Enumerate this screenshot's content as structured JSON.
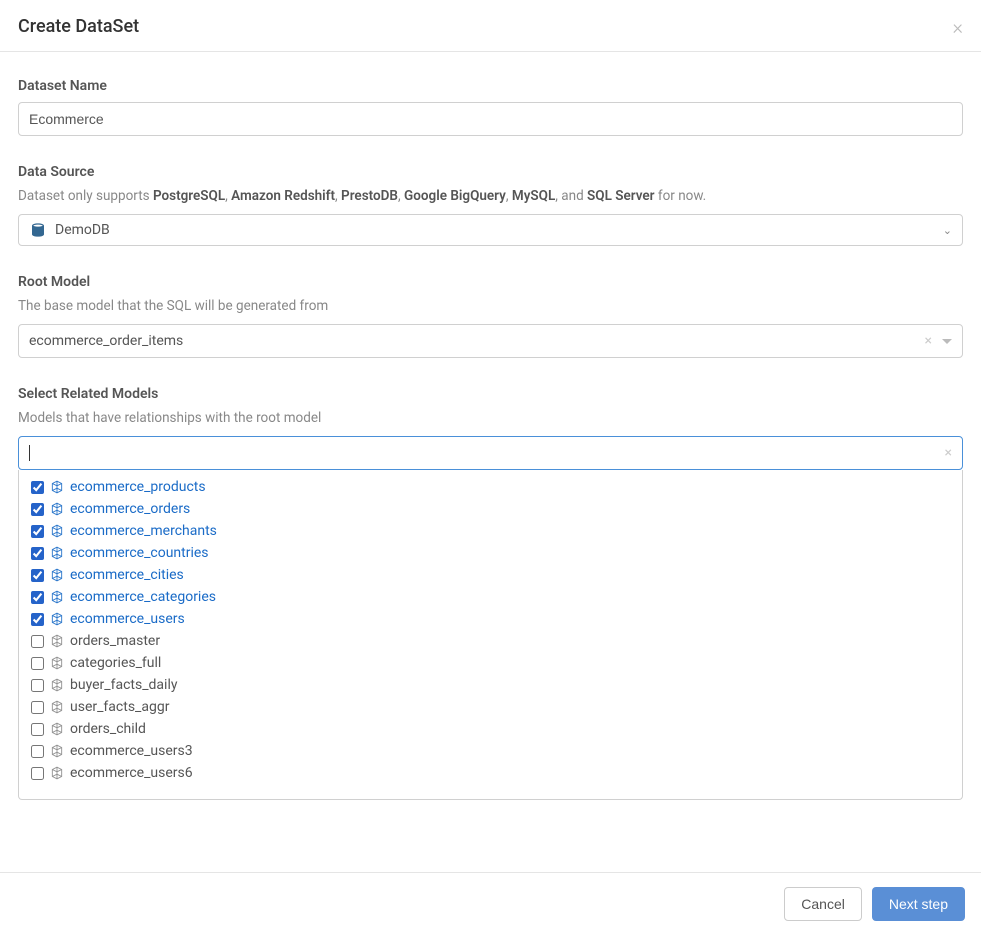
{
  "modal": {
    "title": "Create DataSet",
    "close": "×"
  },
  "dataset_name": {
    "label": "Dataset Name",
    "value": "Ecommerce"
  },
  "data_source": {
    "label": "Data Source",
    "help_prefix": "Dataset only supports ",
    "db1": "PostgreSQL",
    "sep1": ", ",
    "db2": "Amazon Redshift",
    "sep2": ", ",
    "db3": "PrestoDB",
    "sep3": ", ",
    "db4": "Google BigQuery",
    "sep4": ", ",
    "db5": "MySQL",
    "sep5": ", and ",
    "db6": "SQL Server",
    "help_suffix": " for now.",
    "selected": "DemoDB"
  },
  "root_model": {
    "label": "Root Model",
    "help": "The base model that the SQL will be generated from",
    "selected": "ecommerce_order_items",
    "clear": "×"
  },
  "related_models": {
    "label": "Select Related Models",
    "help": "Models that have relationships with the root model",
    "clear": "×",
    "items": [
      {
        "label": "ecommerce_products",
        "checked": true
      },
      {
        "label": "ecommerce_orders",
        "checked": true
      },
      {
        "label": "ecommerce_merchants",
        "checked": true
      },
      {
        "label": "ecommerce_countries",
        "checked": true
      },
      {
        "label": "ecommerce_cities",
        "checked": true
      },
      {
        "label": "ecommerce_categories",
        "checked": true
      },
      {
        "label": "ecommerce_users",
        "checked": true
      },
      {
        "label": "orders_master",
        "checked": false
      },
      {
        "label": "categories_full",
        "checked": false
      },
      {
        "label": "buyer_facts_daily",
        "checked": false
      },
      {
        "label": "user_facts_aggr",
        "checked": false
      },
      {
        "label": "orders_child",
        "checked": false
      },
      {
        "label": "ecommerce_users3",
        "checked": false
      },
      {
        "label": "ecommerce_users6",
        "checked": false
      }
    ]
  },
  "footer": {
    "cancel": "Cancel",
    "next": "Next step"
  },
  "colors": {
    "accent": "#5a8fd6",
    "link": "#1a6bc7"
  }
}
